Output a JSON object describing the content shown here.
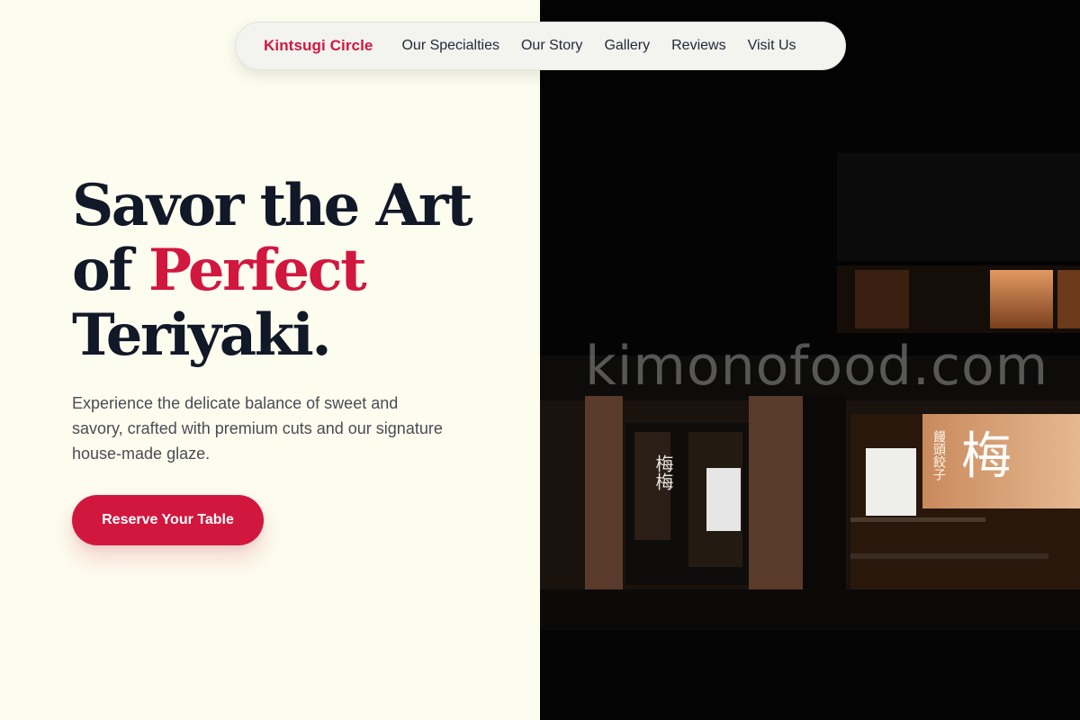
{
  "nav": {
    "brand": "Kintsugi Circle",
    "links": [
      "Our Specialties",
      "Our Story",
      "Gallery",
      "Reviews",
      "Visit Us"
    ]
  },
  "hero": {
    "headline_line1": "Savor the Art",
    "headline_of": "of ",
    "headline_accent": "Perfect",
    "headline_line3": "Teriyaki.",
    "lead": "Experience the delicate balance of sweet and savory, crafted with premium cuts and our signature house-made glaze.",
    "cta_label": "Reserve Your Table"
  },
  "photo": {
    "watermark": "kimonofood.com",
    "sign_left": "梅梅",
    "sign_right_big": "梅",
    "sign_right_small": "饅頭餃子"
  },
  "colors": {
    "accent": "#d2173f",
    "page_background": "#fdfdef",
    "headline": "#111827",
    "photo_background": "#040404"
  }
}
